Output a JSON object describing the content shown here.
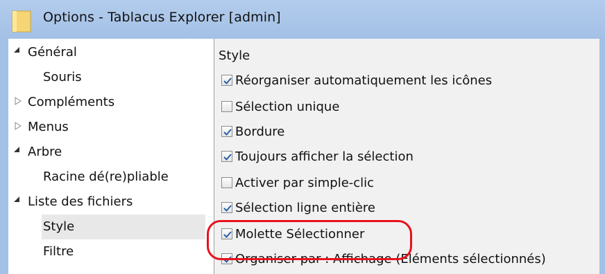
{
  "window": {
    "title": "Options - Tablacus Explorer [admin]"
  },
  "tree": {
    "items": [
      {
        "label": "Général",
        "expander": "expanded"
      },
      {
        "label": "Souris",
        "expander": "none"
      },
      {
        "label": "Compléments",
        "expander": "collapsed"
      },
      {
        "label": "Menus",
        "expander": "collapsed"
      },
      {
        "label": "Arbre",
        "expander": "expanded"
      },
      {
        "label": "Racine dé(re)pliable",
        "expander": "none"
      },
      {
        "label": "Liste des fichiers",
        "expander": "expanded"
      },
      {
        "label": "Style",
        "expander": "none",
        "selected": true
      },
      {
        "label": "Filtre",
        "expander": "none"
      }
    ]
  },
  "content": {
    "section_title": "Style",
    "options": [
      {
        "label": "Réorganiser automatiquement les icônes",
        "checked": true
      },
      {
        "label": "Sélection unique",
        "checked": false
      },
      {
        "label": "Bordure",
        "checked": true
      },
      {
        "label": "Toujours afficher la sélection",
        "checked": true
      },
      {
        "label": "Activer par simple-clic",
        "checked": false
      },
      {
        "label": "Sélection ligne entière",
        "checked": true
      },
      {
        "label": "Molette Sélectionner",
        "checked": true
      },
      {
        "label": "Organiser par : Affichage (Eléments sélectionnés)",
        "checked": true
      }
    ]
  },
  "colors": {
    "titlebar": "#a3c0e6",
    "highlight": "#e8101b",
    "selected_row": "#e8e8e8"
  }
}
